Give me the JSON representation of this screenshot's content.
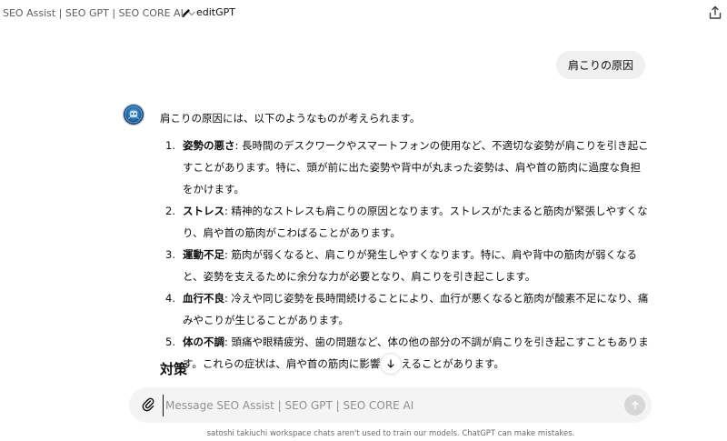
{
  "header": {
    "model_name": "SEO Assist | SEO GPT | SEO CORE AI",
    "edit_label": "editGPT",
    "icons": {
      "dropdown": "chevron-down-icon",
      "edit": "pencil-icon",
      "share": "share-icon"
    }
  },
  "conversation": {
    "user_message": "肩こりの原因",
    "assistant": {
      "intro": "肩こりの原因には、以下のようなものが考えられます。",
      "causes": [
        {
          "num": "1.",
          "term": "姿勢の悪さ",
          "text": ": 長時間のデスクワークやスマートフォンの使用など、不適切な姿勢が肩こりを引き起こすことがあります。特に、頭が前に出た姿勢や背中が丸まった姿勢は、肩や首の筋肉に過度な負担をかけます。"
        },
        {
          "num": "2.",
          "term": "ストレス",
          "text": ": 精神的なストレスも肩こりの原因となります。ストレスがたまると筋肉が緊張しやすくなり、肩や首の筋肉がこわばることがあります。"
        },
        {
          "num": "3.",
          "term": "運動不足",
          "text": ": 筋肉が弱くなると、肩こりが発生しやすくなります。特に、肩や背中の筋肉が弱くなると、姿勢を支えるために余分な力が必要となり、肩こりを引き起こします。"
        },
        {
          "num": "4.",
          "term": "血行不良",
          "text": ": 冷えや同じ姿勢を長時間続けることにより、血行が悪くなると筋肉が酸素不足になり、痛みやこりが生じることがあります。"
        },
        {
          "num": "5.",
          "term": "体の不調",
          "text": ": 頭痛や眼精疲労、歯の問題など、体の他の部分の不調が肩こりを引き起こすこともあります。これらの症状は、肩や首の筋肉に影響を与えることがあります。"
        }
      ],
      "next_heading": "対策"
    }
  },
  "composer": {
    "placeholder": "Message SEO Assist | SEO GPT | SEO CORE AI",
    "value": "",
    "icons": {
      "attach": "paperclip-icon",
      "send": "arrow-up-icon",
      "scroll": "arrow-down-icon"
    }
  },
  "footer": {
    "note": "satoshi takiuchi workspace chats aren't used to train our models. ChatGPT can make mistakes."
  }
}
